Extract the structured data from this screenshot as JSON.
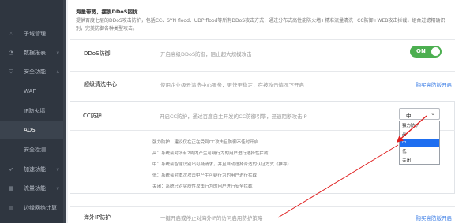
{
  "sidebar": {
    "items": [
      {
        "label": "子域管理",
        "icon": "sitemap-icon",
        "chevron": ""
      },
      {
        "label": "数据报表",
        "icon": "chart-icon",
        "chevron": "∨"
      },
      {
        "label": "安全功能",
        "icon": "shield-icon",
        "chevron": "∧"
      },
      {
        "label": "WAF",
        "icon": "",
        "chevron": ""
      },
      {
        "label": "IP防火墙",
        "icon": "",
        "chevron": ""
      },
      {
        "label": "ADS",
        "icon": "",
        "chevron": ""
      },
      {
        "label": "安全检测",
        "icon": "",
        "chevron": ""
      },
      {
        "label": "加速功能",
        "icon": "rocket-icon",
        "chevron": "∨"
      },
      {
        "label": "流量功能",
        "icon": "grid-icon",
        "chevron": "∨"
      },
      {
        "label": "边缘网络计算",
        "icon": "server-icon",
        "chevron": ""
      }
    ],
    "active_index": 5
  },
  "notice": {
    "title": "海量带宽，摆脱DDoS困扰",
    "desc": "提供百度七层的DDoS攻击防护，包括CC、SYN flood、UDP flood等所有DDoS攻击方式，通过分布式高性能防火墙+精准流量清洗+CC防御+WEB攻击拦截，组合过滤精确识别，完美防御各种类型攻击。"
  },
  "rows": {
    "ddos": {
      "name": "DDoS防御",
      "desc": "开启高级DDoS防御，阻止超大规模攻击",
      "toggle": "ON"
    },
    "clean": {
      "name": "超级清洗中心",
      "desc": "使用企业级云清洗中心服务，更快更稳定，在被攻击情况下开启",
      "link": "购买高防版开启"
    },
    "cc": {
      "name": "CC防护",
      "desc": "开启CC防护，通过百度自主开发的CC防御引擎，迅速阻断攻击IP"
    },
    "overseas": {
      "name": "海外IP防护",
      "desc": "一键开启或停止对海外IP的访问启用防护策略",
      "link": "购买高防版开启"
    }
  },
  "cc_options": [
    "强力防护：建议仅在正在受到CC攻击且防御不佳时开启",
    "高：系统会对所有2周内产生可疑行为的用户进行选择性拦截",
    "中：系统会智能识别出可疑请求，并且自动选择合适的认证方式（推荐）",
    "低：系统会对本次攻击中产生可疑行为的用户进行拦截",
    "关闭：系统只对实质性攻击行为的用户进行安全拦截"
  ],
  "cc_select": {
    "value": "中",
    "options": [
      "强力防护",
      "高",
      "中",
      "低",
      "关闭"
    ],
    "highlighted_index": 2
  },
  "colors": {
    "accent": "#3b7de6",
    "toggle_on": "#4caf50",
    "arrow": "#e02020",
    "sidebar_bg": "#2f3640"
  }
}
